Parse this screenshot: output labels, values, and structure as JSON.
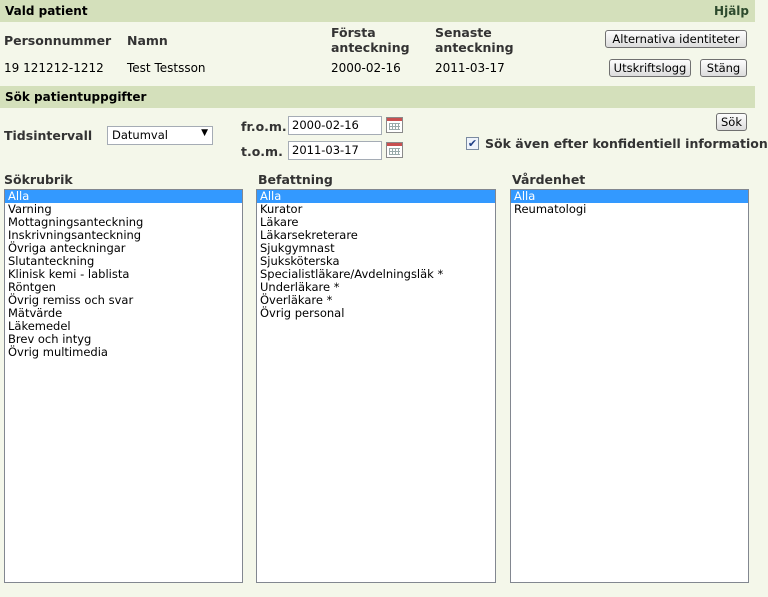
{
  "header": {
    "title": "Vald patient",
    "help": "Hjälp"
  },
  "patient": {
    "cols": [
      "Personnummer",
      "Namn",
      "Första anteckning",
      "Senaste anteckning"
    ],
    "personnummer": "19 121212-1212",
    "namn": "Test Testsson",
    "forsta": "2000-02-16",
    "senaste": "2011-03-17",
    "buttons": {
      "alternativa": "Alternativa identiteter",
      "utskriftslogg": "Utskriftslogg",
      "stang": "Stäng"
    }
  },
  "search": {
    "title": "Sök patientuppgifter",
    "tidsintervall_label": "Tidsintervall",
    "tidsintervall_value": "Datumval",
    "from_label": "fr.o.m.",
    "from_value": "2000-02-16",
    "tom_label": "t.o.m.",
    "tom_value": "2011-03-17",
    "sok_button": "Sök",
    "confidential_label": "Sök även efter konfidentiell information",
    "confidential_checked": true
  },
  "lists": {
    "sokrubrik": {
      "label": "Sökrubrik",
      "items": [
        "Alla",
        "Varning",
        "Mottagningsanteckning",
        "Inskrivningsanteckning",
        "Övriga anteckningar",
        "Slutanteckning",
        "Klinisk kemi - lablista",
        "Röntgen",
        "Övrig remiss och svar",
        "Mätvärde",
        "Läkemedel",
        "Brev och intyg",
        "Övrig multimedia"
      ]
    },
    "befattning": {
      "label": "Befattning",
      "items": [
        "Alla",
        "Kurator",
        "Läkare",
        "Läkarsekreterare",
        "Sjukgymnast",
        "Sjuksköterska",
        "Specialistläkare/Avdelningsläk *",
        "Underläkare *",
        "Överläkare *",
        "Övrig personal"
      ]
    },
    "vardenhet": {
      "label": "Vårdenhet",
      "items": [
        "Alla",
        "Reumatologi"
      ]
    }
  },
  "colors": {
    "bar": "#d4e0bb",
    "selection": "#3399ff"
  }
}
